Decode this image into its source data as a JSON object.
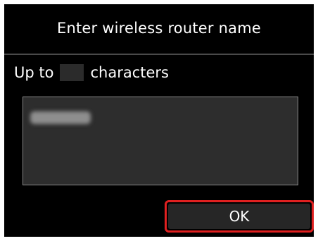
{
  "title": "Enter wireless router name",
  "hint": {
    "prefix": "Up to",
    "suffix": "characters"
  },
  "ok_button": {
    "label": "OK",
    "highlight_color": "#e02020"
  },
  "colors": {
    "background": "#000000",
    "text": "#ffffff",
    "field_background": "#2d2d2d",
    "button_background": "#262626"
  }
}
